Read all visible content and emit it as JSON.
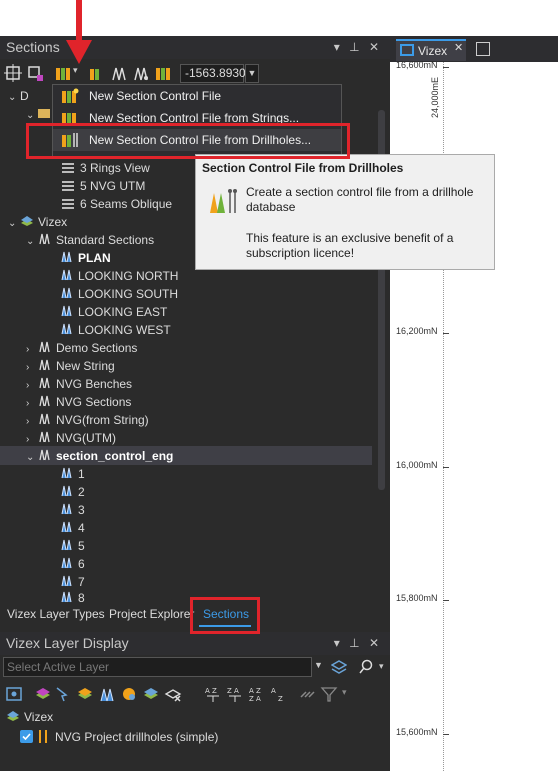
{
  "sections_panel": {
    "title": "Sections"
  },
  "toolbar": {
    "coordinate_value": "-1563.8930"
  },
  "context_menu": {
    "items": [
      {
        "label": "New Section Control File"
      },
      {
        "label": "New Section Control File from Strings..."
      },
      {
        "label": "New Section Control File from Drillholes..."
      }
    ]
  },
  "tooltip": {
    "title": "Section Control File from Drillholes",
    "description": "Create a section control file from a drillhole database",
    "note": "This feature is an exclusive benefit of a subscription licence!"
  },
  "tree": {
    "partial_root": "D",
    "views": [
      "3 Rings View",
      "5 NVG UTM",
      "6 Seams Oblique"
    ],
    "vizex_root": "Vizex",
    "standard_sections": "Standard Sections",
    "standard_items": [
      "PLAN",
      "LOOKING NORTH",
      "LOOKING SOUTH",
      "LOOKING EAST",
      "LOOKING WEST"
    ],
    "groups": [
      "Demo Sections",
      "New String",
      "NVG Benches",
      "NVG Sections",
      "NVG(from String)",
      "NVG(UTM)"
    ],
    "section_control": "section_control_eng",
    "section_numbers": [
      "1",
      "2",
      "3",
      "4",
      "5",
      "6",
      "7",
      "8"
    ]
  },
  "bottom_tabs": [
    "Vizex Layer Types",
    "Project Explorer",
    "Sections"
  ],
  "layer_display": {
    "title": "Vizex Layer Display",
    "active_layer_placeholder": "Select Active Layer",
    "root": "Vizex",
    "layer": "NVG Project drillholes (simple)"
  },
  "viewport": {
    "tab_label": "Vizex",
    "y_labels": [
      "16,600mN",
      "16,200mN",
      "16,000mN",
      "15,800mN",
      "15,600mN"
    ],
    "x_label": "24,000mE"
  },
  "colors": {
    "accent": "#3c9be8",
    "annotation": "#e0242b",
    "selection": "#3e3e42"
  },
  "icons": [
    "red-annotation-arrow",
    "section-file-icon",
    "list-icon",
    "book-icon",
    "close-icon",
    "pin-icon",
    "search-icon",
    "funnel-icon",
    "checkbox-icon"
  ]
}
